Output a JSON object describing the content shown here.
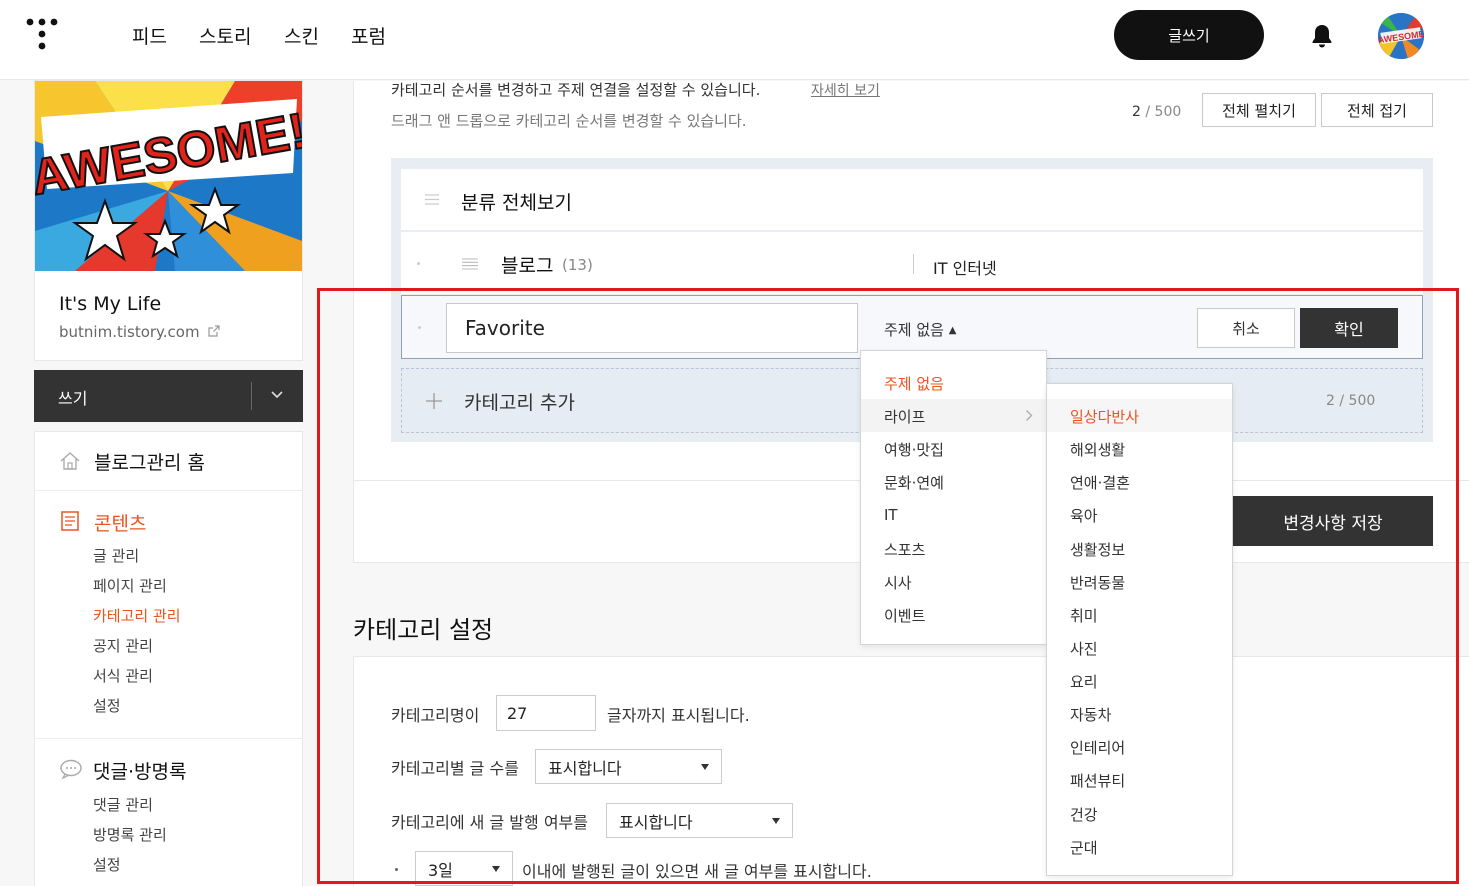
{
  "header": {
    "nav": [
      "피드",
      "스토리",
      "스킨",
      "포럼"
    ],
    "write_label": "글쓰기"
  },
  "sidebar": {
    "blog_title": "It's My Life",
    "blog_url": "butnim.tistory.com",
    "write_label": "쓰기",
    "home_label": "블로그관리 홈",
    "contents_label": "콘텐츠",
    "contents_items": [
      "글 관리",
      "페이지 관리",
      "카테고리 관리",
      "공지 관리",
      "서식 관리",
      "설정"
    ],
    "comments_label": "댓글·방명록",
    "comments_items": [
      "댓글 관리",
      "방명록 관리",
      "설정"
    ]
  },
  "main": {
    "desc1": "카테고리 순서를 변경하고 주제 연결을 설정할 수 있습니다.",
    "detail_link": "자세히 보기",
    "desc2": "드래그 앤 드롭으로 카테고리 순서를 변경할 수 있습니다.",
    "count_used": "2",
    "count_max": "/ 500",
    "expand_all": "전체 펼치기",
    "collapse_all": "전체 접기",
    "all_view": "분류 전체보기",
    "blog_item": {
      "name": "블로그",
      "count": "(13)",
      "topic": "IT 인터넷"
    },
    "editing": {
      "value": "Favorite",
      "topic": "주제 없음",
      "cancel": "취소",
      "confirm": "확인"
    },
    "add_label": "카테고리 추가",
    "add_count_used": "2",
    "add_count_max": "/ 500",
    "save_label": "변경사항 저장",
    "settings_title": "카테고리 설정",
    "settings": {
      "name_prefix": "카테고리명이",
      "name_value": "27",
      "name_suffix": "글자까지 표시됩니다.",
      "count_label": "카테고리별 글 수를",
      "count_value": "표시합니다",
      "new_label": "카테고리에 새 글 발행 여부를",
      "new_value": "표시합니다",
      "days_value": "3일",
      "days_suffix": "이내에 발행된 글이 있으면 새 글 여부를 표시합니다."
    }
  },
  "dropdown": {
    "items": [
      "주제 없음",
      "라이프",
      "여행·맛집",
      "문화·연예",
      "IT",
      "스포츠",
      "시사",
      "이벤트"
    ],
    "sub_items": [
      "일상다반사",
      "해외생활",
      "연애·결혼",
      "육아",
      "생활정보",
      "반려동물",
      "취미",
      "사진",
      "요리",
      "자동차",
      "인테리어",
      "패션뷰티",
      "건강",
      "군대"
    ]
  },
  "colors": {
    "accent": "#eb531f",
    "highlight_box": "#e0191e",
    "dark": "#333333"
  }
}
